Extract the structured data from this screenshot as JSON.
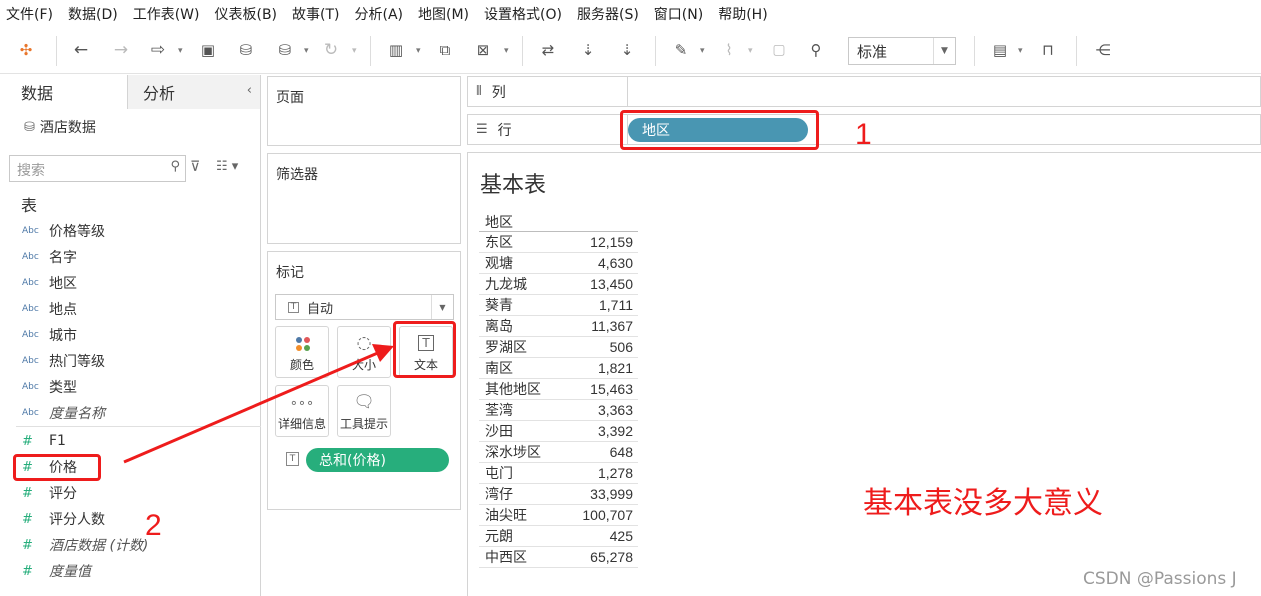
{
  "menu": [
    "文件(F)",
    "数据(D)",
    "工作表(W)",
    "仪表板(B)",
    "故事(T)",
    "分析(A)",
    "地图(M)",
    "设置格式(O)",
    "服务器(S)",
    "窗口(N)",
    "帮助(H)"
  ],
  "toolbar": {
    "fit_value": "标准",
    "icons": [
      "tableau-logo-icon",
      "back-icon",
      "forward-icon",
      "replay-icon",
      "save-icon",
      "new-datasource-icon",
      "pause-icon",
      "refresh-icon",
      "new-worksheet-icon",
      "duplicate-icon",
      "clear-icon",
      "swap-icon",
      "sort-asc-icon",
      "sort-desc-icon",
      "highlight-icon",
      "group-icon",
      "label-icon",
      "pin-icon",
      "show-me-icon",
      "presentation-icon",
      "share-icon"
    ]
  },
  "left_pane": {
    "tab_data": "数据",
    "tab_analysis": "分析",
    "datasource": "酒店数据",
    "search_placeholder": "搜索",
    "fields_heading": "表",
    "dimensions": [
      {
        "type": "Abc",
        "name": "价格等级"
      },
      {
        "type": "Abc",
        "name": "名字"
      },
      {
        "type": "Abc",
        "name": "地区"
      },
      {
        "type": "Abc",
        "name": "地点"
      },
      {
        "type": "Abc",
        "name": "城市"
      },
      {
        "type": "Abc",
        "name": "热门等级"
      },
      {
        "type": "Abc",
        "name": "类型"
      },
      {
        "type": "Abc",
        "name": "度量名称"
      }
    ],
    "measures": [
      {
        "type": "#",
        "name": "F1"
      },
      {
        "type": "#",
        "name": "价格"
      },
      {
        "type": "#",
        "name": "评分"
      },
      {
        "type": "#",
        "name": "评分人数"
      },
      {
        "type": "#",
        "name": "酒店数据 (计数)"
      },
      {
        "type": "#",
        "name": "度量值"
      }
    ]
  },
  "cards": {
    "pages": "页面",
    "filters": "筛选器",
    "marks": "标记",
    "marks_type": "自动",
    "color": "颜色",
    "size": "大小",
    "text": "文本",
    "detail": "详细信息",
    "tooltip": "工具提示",
    "measure_pill": "总和(价格)"
  },
  "shelves": {
    "columns": "列",
    "rows": "行",
    "rows_pill": "地区"
  },
  "view": {
    "title": "基本表",
    "column_header": "地区",
    "rows": [
      {
        "region": "东区",
        "value": "12,159"
      },
      {
        "region": "观塘",
        "value": "4,630"
      },
      {
        "region": "九龙城",
        "value": "13,450"
      },
      {
        "region": "葵青",
        "value": "1,711"
      },
      {
        "region": "离岛",
        "value": "11,367"
      },
      {
        "region": "罗湖区",
        "value": "506"
      },
      {
        "region": "南区",
        "value": "1,821"
      },
      {
        "region": "其他地区",
        "value": "15,463"
      },
      {
        "region": "荃湾",
        "value": "3,363"
      },
      {
        "region": "沙田",
        "value": "3,392"
      },
      {
        "region": "深水埗区",
        "value": "648"
      },
      {
        "region": "屯门",
        "value": "1,278"
      },
      {
        "region": "湾仔",
        "value": "33,999"
      },
      {
        "region": "油尖旺",
        "value": "100,707"
      },
      {
        "region": "元朗",
        "value": "425"
      },
      {
        "region": "中西区",
        "value": "65,278"
      }
    ]
  },
  "annotations": {
    "label_1": "1",
    "label_2": "2",
    "note": "基本表没多大意义",
    "color": "#ee1c1c"
  },
  "watermark": "CSDN @Passions J",
  "colors": {
    "dimension_pill": "#4996b2",
    "measure_pill": "#27ae7c"
  }
}
